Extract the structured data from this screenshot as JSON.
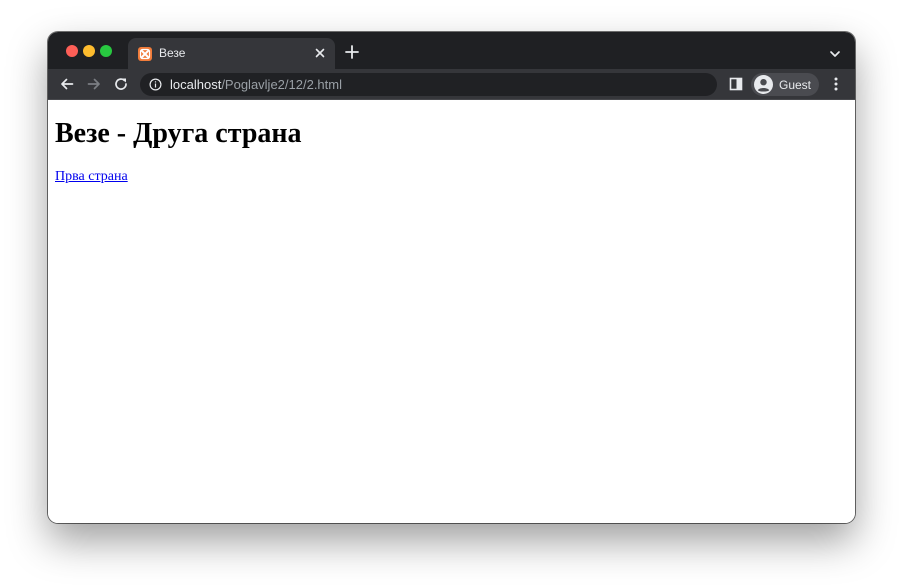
{
  "browser": {
    "tab": {
      "title": "Везе",
      "favicon": "xampp-icon"
    },
    "address_bar": {
      "host": "localhost",
      "path": "/Poglavlje2/12/2.html"
    },
    "profile": {
      "label": "Guest"
    },
    "icons": {
      "back": "arrow-left-icon",
      "forward": "arrow-right-icon",
      "reload": "reload-icon",
      "site_info": "info-icon",
      "side_panel": "side-panel-icon",
      "menu": "kebab-menu-icon",
      "new_tab": "plus-icon",
      "tab_close": "close-icon",
      "tab_search": "chevron-down-icon"
    },
    "colors": {
      "frame": "#1f2023",
      "toolbar": "#35363a",
      "omnibox": "#202124",
      "favicon": "#f17c3a"
    }
  },
  "page": {
    "heading": "Везе - Друга страна",
    "link": "Прва страна",
    "link_color": "#0000ee"
  }
}
